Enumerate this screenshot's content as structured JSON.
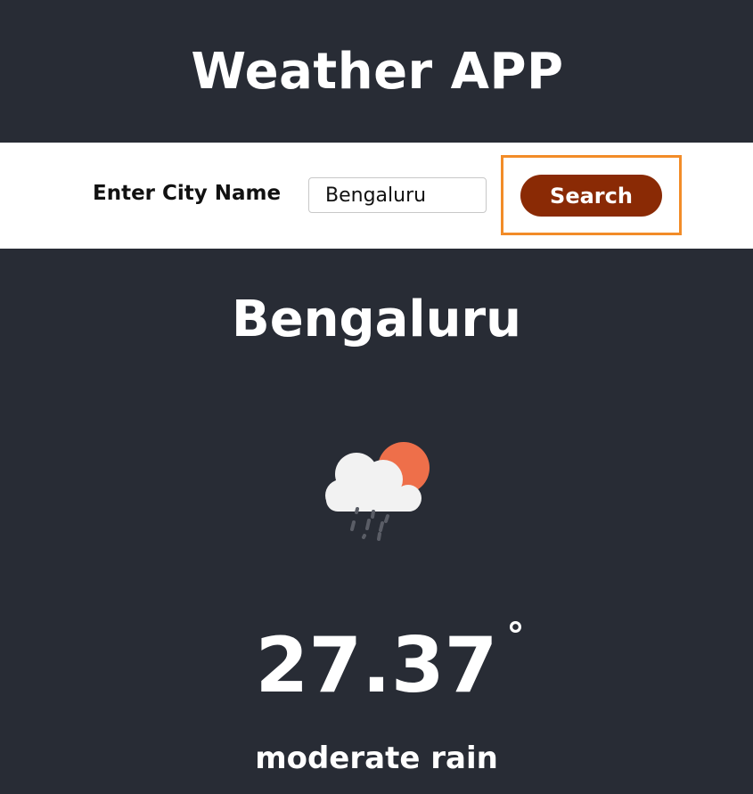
{
  "app": {
    "title": "Weather APP"
  },
  "search": {
    "label": "Enter City Name",
    "input_value": "Bengaluru",
    "button_label": "Search"
  },
  "weather": {
    "city": "Bengaluru",
    "icon": "cloud-sun-rain-icon",
    "temperature": "27.37",
    "degree_symbol": "°",
    "description": "moderate rain"
  },
  "colors": {
    "background": "#282c35",
    "search_bar": "#ffffff",
    "button": "#8a2a05",
    "highlight_border": "#f28c28",
    "sun": "#ee6f4a",
    "cloud": "#f2f2f2",
    "rain": "#5a5d66"
  }
}
